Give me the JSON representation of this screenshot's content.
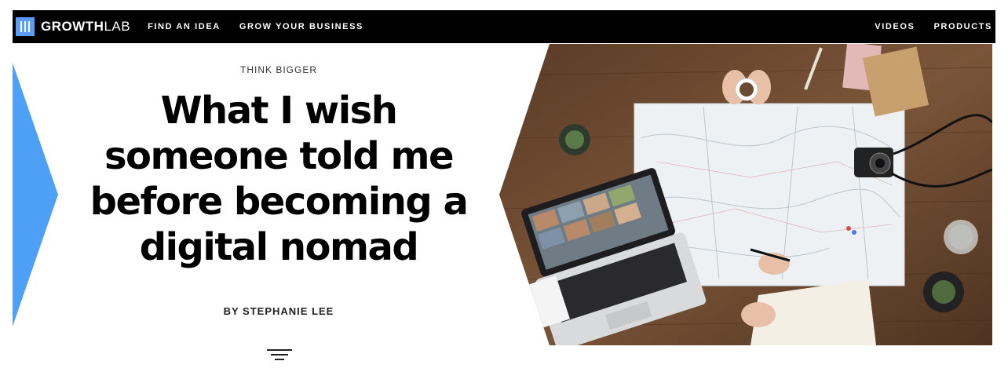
{
  "brand": {
    "name_bold": "GROWTH",
    "name_light": "LAB"
  },
  "nav": {
    "left": [
      {
        "label": "FIND AN IDEA"
      },
      {
        "label": "GROW YOUR BUSINESS"
      }
    ],
    "right": [
      {
        "label": "VIDEOS"
      },
      {
        "label": "PRODUCTS"
      }
    ]
  },
  "article": {
    "kicker": "THINK BIGGER",
    "title": "What I wish someone told me before becoming a digital nomad",
    "byline": "BY STEPHANIE LEE"
  },
  "colors": {
    "accent": "#4da0f5",
    "navbar": "#000000",
    "wood": "#6b4a32"
  },
  "icons": {
    "logo": "growthlab-logo-icon",
    "menu": "hamburger-icon"
  }
}
